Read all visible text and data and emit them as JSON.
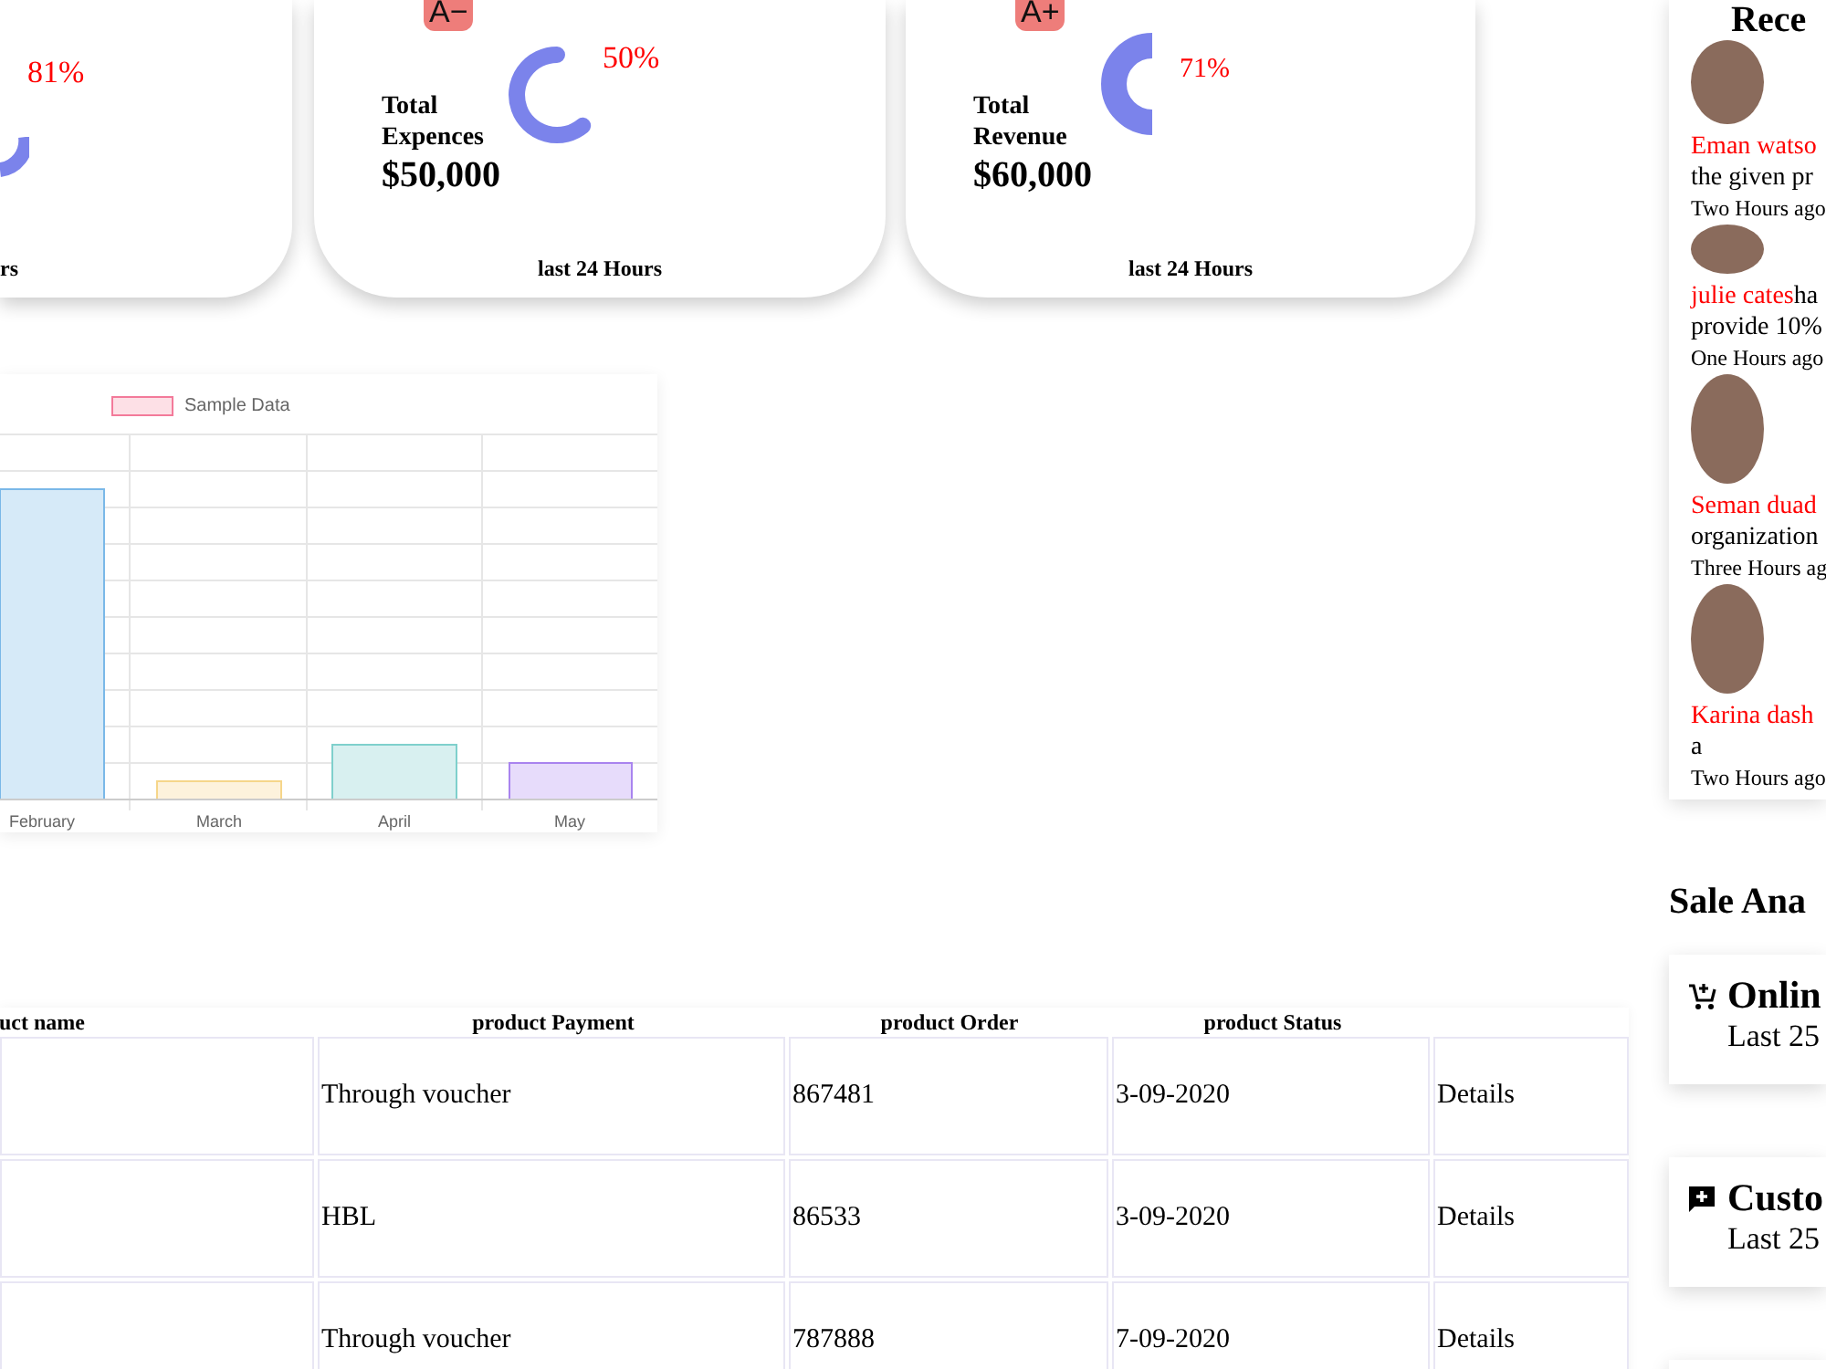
{
  "stat_cards": [
    {
      "percent": "81%",
      "footer": "rs"
    },
    {
      "badge": "A−",
      "title": "Total Expences",
      "amount": "$50,000",
      "percent": "50%",
      "footer": "last 24 Hours"
    },
    {
      "badge": "A+",
      "title": "Total Revenue",
      "amount": "$60,000",
      "percent": "71%",
      "footer": "last 24 Hours"
    }
  ],
  "bar_chart": {
    "legend": "Sample Data",
    "categories": [
      "February",
      "March",
      "April",
      "May"
    ]
  },
  "table": {
    "columns": [
      "uct name",
      "product Payment",
      "product Order",
      "product Status"
    ],
    "rows": [
      {
        "cells": [
          "",
          "Through voucher",
          "867481",
          "3-09-2020",
          "Details"
        ]
      },
      {
        "cells": [
          "",
          "HBL",
          "86533",
          "3-09-2020",
          "Details"
        ]
      },
      {
        "cells": [
          "",
          "Through voucher",
          "787888",
          "7-09-2020",
          "Details"
        ]
      }
    ]
  },
  "recent": {
    "title": "Rece",
    "items": [
      {
        "name": "Eman watso",
        "line2": "the given pr",
        "time": "Two Hours ago"
      },
      {
        "name": "julie cates",
        "text": "ha",
        "line2": "provide 10%",
        "time": "One Hours ago"
      },
      {
        "name": "Seman duad",
        "line2": "organization",
        "time": "Three Hours ag"
      },
      {
        "name": "Karina dash",
        "line2": "a",
        "time": "Two Hours ago"
      }
    ]
  },
  "sale_analysis": {
    "title": "Sale Ana",
    "cards": [
      {
        "title": "Onlin",
        "subtitle": "Last 25"
      },
      {
        "title": "Custo",
        "subtitle": "Last 25"
      }
    ]
  }
}
